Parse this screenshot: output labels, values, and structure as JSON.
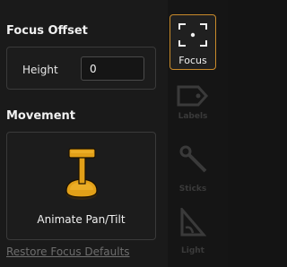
{
  "focus_offset": {
    "title": "Focus Offset",
    "height_label": "Height",
    "height_value": "0"
  },
  "movement": {
    "title": "Movement",
    "animate_label": "Animate Pan/Tilt"
  },
  "restore_link": "Restore Focus Defaults",
  "toolbar": {
    "items": [
      {
        "label": "Focus",
        "icon": "focus-icon",
        "active": true
      },
      {
        "label": "Labels",
        "icon": "label-tag-icon",
        "active": false
      },
      {
        "label": "Sticks",
        "icon": "stick-icon",
        "active": false
      },
      {
        "label": "Light",
        "icon": "light-icon",
        "active": false
      }
    ]
  },
  "colors": {
    "accent": "#c98b2b",
    "joystick": "#e2a018"
  }
}
